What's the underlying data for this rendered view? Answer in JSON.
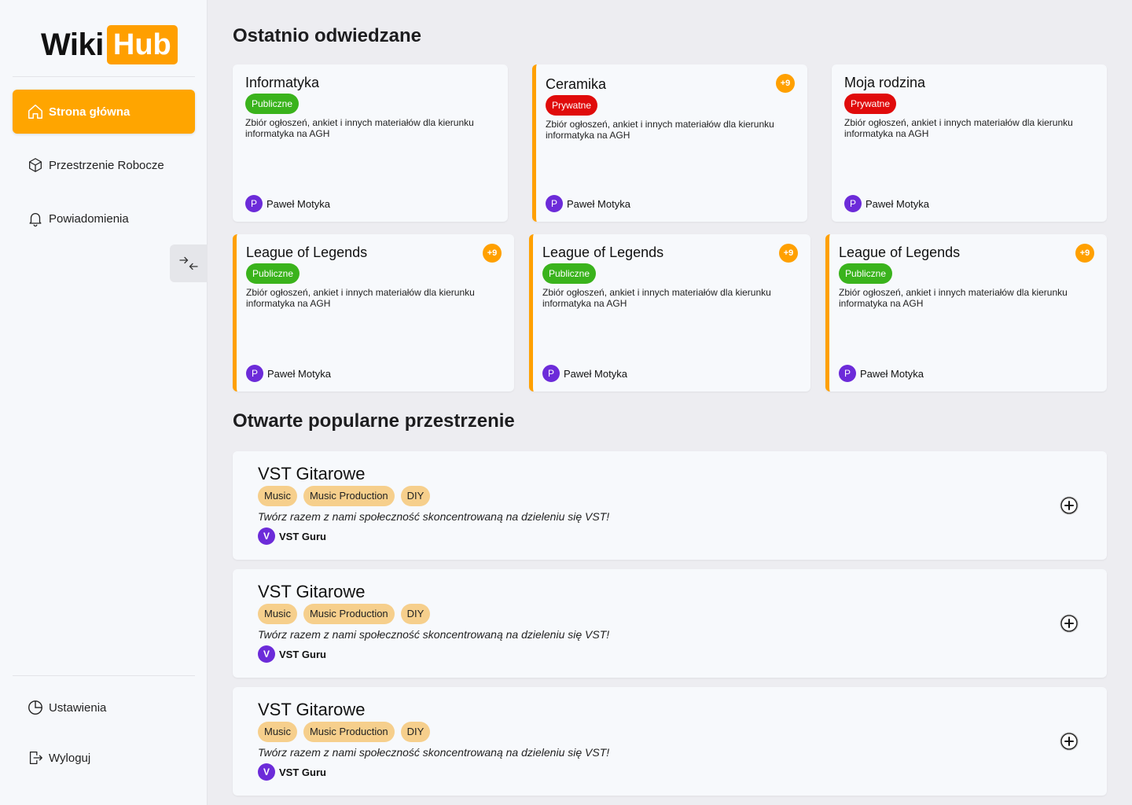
{
  "logo": {
    "part1": "Wiki",
    "part2": "Hub"
  },
  "nav": {
    "home": "Strona główna",
    "workspaces": "Przestrzenie Robocze",
    "notifications": "Powiadomienia",
    "settings": "Ustawienia",
    "logout": "Wyloguj"
  },
  "recent": {
    "title": "Ostatnio odwiedzane",
    "cards": [
      {
        "title": "Informatyka",
        "visibility": "Publiczne",
        "desc": "Zbiór ogłoszeń, ankiet i innych materiałów dla kierunku informatyka na AGH",
        "author": "Paweł Motyka",
        "avatar": "P",
        "notif": ""
      },
      {
        "title": "Ceramika",
        "visibility": "Prywatne",
        "desc": "Zbiór ogłoszeń, ankiet i innych materiałów dla kierunku informatyka na AGH",
        "author": "Paweł Motyka",
        "avatar": "P",
        "notif": "+9"
      },
      {
        "title": "Moja rodzina",
        "visibility": "Prywatne",
        "desc": "Zbiór ogłoszeń, ankiet i innych materiałów dla kierunku informatyka na AGH",
        "author": "Paweł Motyka",
        "avatar": "P",
        "notif": ""
      },
      {
        "title": "League of Legends",
        "visibility": "Publiczne",
        "desc": "Zbiór ogłoszeń, ankiet i innych materiałów dla kierunku informatyka na AGH",
        "author": "Paweł Motyka",
        "avatar": "P",
        "notif": "+9"
      },
      {
        "title": "League of Legends",
        "visibility": "Publiczne",
        "desc": "Zbiór ogłoszeń, ankiet i innych materiałów dla kierunku informatyka na AGH",
        "author": "Paweł Motyka",
        "avatar": "P",
        "notif": "+9"
      },
      {
        "title": "League of Legends",
        "visibility": "Publiczne",
        "desc": "Zbiór ogłoszeń, ankiet i innych materiałów dla kierunku informatyka na AGH",
        "author": "Paweł Motyka",
        "avatar": "P",
        "notif": "+9"
      }
    ]
  },
  "popular": {
    "title": "Otwarte popularne przestrzenie",
    "spaces": [
      {
        "title": "VST Gitarowe",
        "tags": [
          "Music",
          "Music Production",
          "DIY"
        ],
        "desc": "Twórz razem z nami społeczność skoncentrowaną na dzieleniu się VST!",
        "author": "VST Guru",
        "avatar": "V"
      },
      {
        "title": "VST Gitarowe",
        "tags": [
          "Music",
          "Music Production",
          "DIY"
        ],
        "desc": "Twórz razem z nami społeczność skoncentrowaną na dzieleniu się VST!",
        "author": "VST Guru",
        "avatar": "V"
      },
      {
        "title": "VST Gitarowe",
        "tags": [
          "Music",
          "Music Production",
          "DIY"
        ],
        "desc": "Twórz razem z nami społeczność skoncentrowaną na dzieleniu się VST!",
        "author": "VST Guru",
        "avatar": "V"
      }
    ]
  },
  "colors": {
    "accent": "#ffa500",
    "public": "#3ab31c",
    "private": "#e00b0b",
    "avatar": "#6c2bd9",
    "tag": "#f6cf8c"
  },
  "icons": {
    "home": "home-icon",
    "workspaces": "cube-icon",
    "notifications": "bell-icon",
    "settings": "pie-chart-icon",
    "logout": "logout-icon",
    "collapse": "collapse-arrows-icon",
    "add": "plus-circle-icon"
  }
}
